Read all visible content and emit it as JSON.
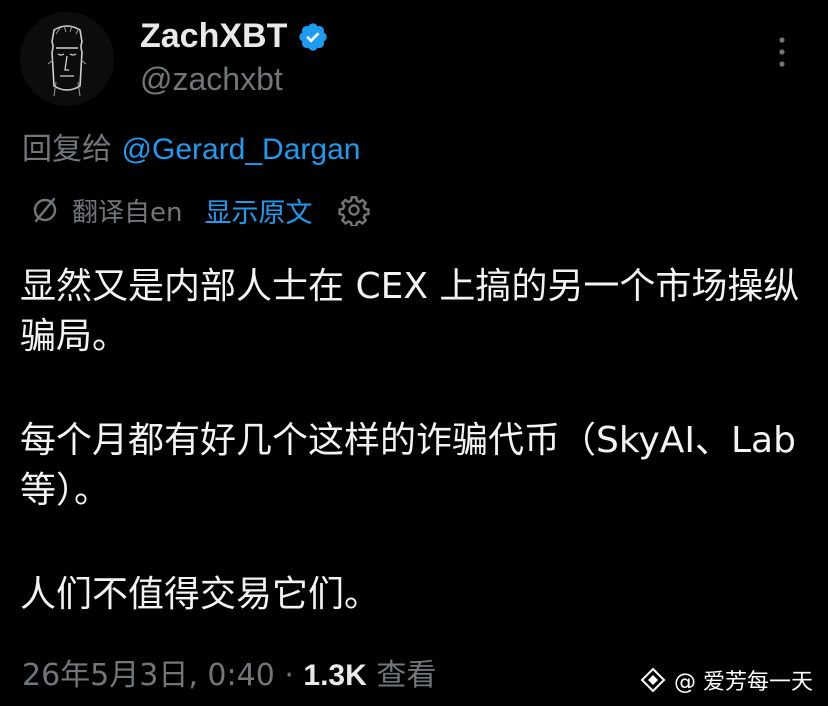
{
  "author": {
    "display_name": "ZachXBT",
    "handle": "@zachxbt",
    "verified_icon": "verified-badge-icon",
    "avatar_icon": "moai-statue-avatar"
  },
  "reply": {
    "prefix": "回复给 ",
    "mention": "@Gerard_Dargan"
  },
  "translation": {
    "translated_from": "翻译自en",
    "show_original": "显示原文",
    "settings_icon": "gear-icon"
  },
  "post": {
    "paragraph_1": "显然又是内部人士在 CEX 上搞的另一个市场操纵骗局。",
    "paragraph_2": "每个月都有好几个这样的诈骗代币（SkyAI、Lab 等）。",
    "paragraph_3": "人们不值得交易它们。"
  },
  "meta": {
    "timestamp": "26年5月3日, 0:40",
    "separator": " · ",
    "views_count": "1.3K",
    "views_label": " 查看"
  },
  "watermark": {
    "text": "@ 爱芳每一天"
  },
  "colors": {
    "background": "#000000",
    "primary_text": "#e7e9ea",
    "secondary_text": "#71767b",
    "accent": "#1d9bf0"
  }
}
